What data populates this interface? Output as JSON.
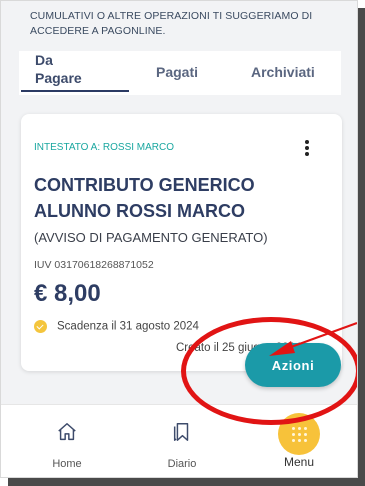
{
  "notice": "CUMULATIVI O ALTRE OPERAZIONI TI SUGGERIAMO DI ACCEDERE A PAGONLINE.",
  "tabs": [
    {
      "label_line1": "Da",
      "label_line2": "Pagare"
    },
    {
      "label": "Pagati"
    },
    {
      "label": "Archiviati"
    }
  ],
  "card": {
    "intestato": "INTESTATO A: ROSSI MARCO",
    "title": "CONTRIBUTO GENERICO ALUNNO ROSSI MARCO",
    "subtitle": "(AVVISO DI PAGAMENTO GENERATO)",
    "iuv": "IUV 03170618268871052",
    "amount": "€ 8,00",
    "due": "Scadenza il 31 agosto 2024",
    "created": "Creato il 25 giugno 2024"
  },
  "action_button": "Azioni",
  "nav": {
    "home": "Home",
    "diario": "Diario",
    "menu": "Menu"
  },
  "colors": {
    "primary": "#2e3d63",
    "accent": "#1b9aa8",
    "menu": "#f7c23a",
    "annotation": "#e11414"
  }
}
